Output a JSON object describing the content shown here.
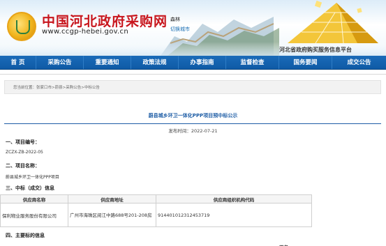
{
  "header": {
    "site_title": "中国河北政府采购网",
    "site_url": "www.ccgp-hebei.gov.cn",
    "user_name": "森林",
    "logout_label": "切换城市",
    "platform_label": "河北省政府购买服务信息平台"
  },
  "nav": {
    "items": [
      {
        "label": "首  页"
      },
      {
        "label": "采购公告"
      },
      {
        "label": "重要通知"
      },
      {
        "label": "政策法规"
      },
      {
        "label": "办事指南"
      },
      {
        "label": "监督检查"
      },
      {
        "label": "国务要闻"
      },
      {
        "label": "成交公告"
      }
    ]
  },
  "breadcrumb": {
    "text": "您当前位置：张家口市>蔚县>采购公告>中标公告"
  },
  "notice": {
    "title": "蔚县城乡环卫一体化PPP项目预中标公示",
    "publish_date": "发布时间：2022-07-21"
  },
  "sections": {
    "s1_heading": "一、项目编号：",
    "s1_value": "ZCZX-ZB-2022-05",
    "s2_heading": "二、项目名称：",
    "s2_value": "蔚县城乡环卫一体化PPP项目",
    "s3_heading": "三、中标（成交）信息",
    "s4_heading": "四、主要标的信息"
  },
  "table": {
    "headers": [
      "供应商名称",
      "供应商地址",
      "供应商组织机构代码"
    ],
    "rows": [
      {
        "name": "保利物业服务股份有限公司",
        "address": "广州市海珠区阅江中路688号201-208房",
        "code": "91440101231245371​9"
      }
    ]
  },
  "trailing": {
    "heading": "服务"
  },
  "colors": {
    "nav_blue": "#1a6bb9",
    "title_red": "#c8161d",
    "link_blue": "#1d5ca5"
  }
}
